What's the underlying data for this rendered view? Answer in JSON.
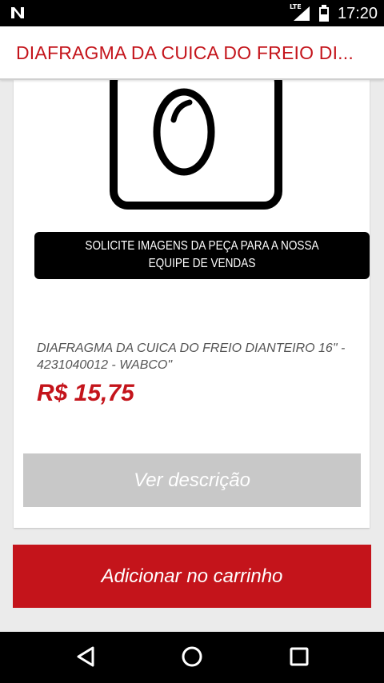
{
  "status_bar": {
    "network_label": "LTE",
    "time": "17:20"
  },
  "app_bar": {
    "title": "DIAFRAGMA DA CUICA DO FREIO DI..."
  },
  "product": {
    "image_notice": "SOLICITE IMAGENS DA PEÇA PARA A NOSSA EQUIPE DE VENDAS",
    "name": "DIAFRAGMA DA CUICA DO FREIO DIANTEIRO 16\" - 4231040012 - WABCO\"",
    "price": "R$ 15,75",
    "details_button": "Ver descrição"
  },
  "cart": {
    "add_button": "Adicionar no carrinho"
  },
  "colors": {
    "brand_red": "#c4141b",
    "disabled_gray": "#c8c8c8",
    "background": "#ebebeb"
  },
  "icons": {
    "status_left": "notification-n-icon",
    "signal": "signal-icon",
    "battery": "battery-icon",
    "product_placeholder": "camera-icon",
    "nav_back": "back-icon",
    "nav_home": "home-icon",
    "nav_recents": "recents-icon"
  }
}
